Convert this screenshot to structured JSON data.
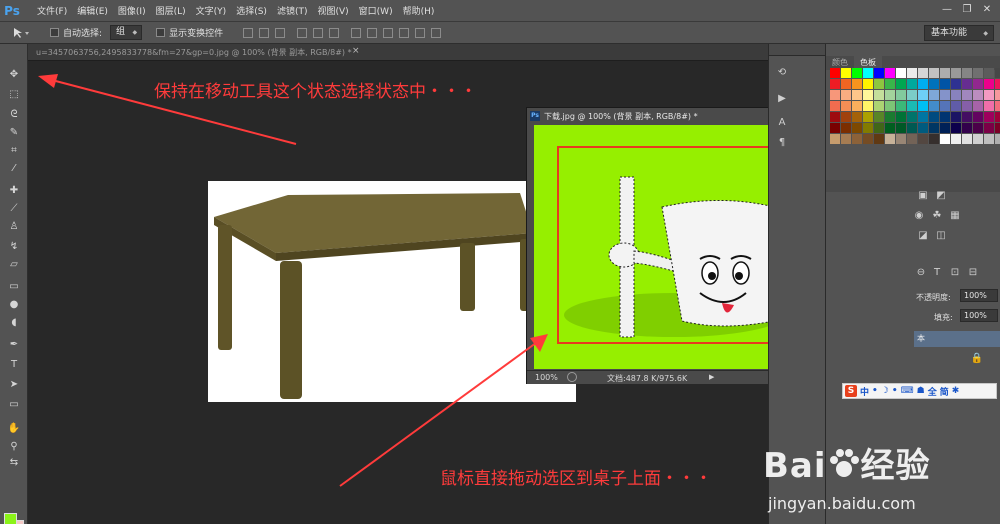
{
  "app": {
    "logo": "Ps"
  },
  "menu": [
    "文件(F)",
    "编辑(E)",
    "图像(I)",
    "图层(L)",
    "文字(Y)",
    "选择(S)",
    "滤镜(T)",
    "视图(V)",
    "窗口(W)",
    "帮助(H)"
  ],
  "window_controls": {
    "minimize": "—",
    "restore": "❐",
    "close": "✕"
  },
  "options": {
    "auto_select_label": "自动选择:",
    "auto_select_value": "组",
    "show_transform_label": "显示变换控件",
    "workspace": "基本功能"
  },
  "doc_tab": {
    "title": "u=3457063756,2495833778&fm=27&gp=0.jpg @ 100% (背景 副本, RGB/8#) *",
    "close": "×"
  },
  "float_window": {
    "title": "下载.jpg @ 100% (背景 副本, RGB/8#) *",
    "zoom": "100%",
    "doc_info": "文档:487.8 K/975.6K",
    "ps_badge": "Ps",
    "btn_min": "—",
    "btn_max": "☐",
    "btn_close": "✕",
    "status_arrow": "▶"
  },
  "panels": {
    "tab_color": "颜色",
    "tab_swatches": "色板",
    "opacity_label": "不透明度:",
    "opacity_value": "100%",
    "fill_label": "填充:",
    "fill_value": "100%",
    "layer_name": "本"
  },
  "annotations": {
    "top": "保持在移动工具这个状态选择状态中・・・",
    "bottom": "鼠标直接拖动选区到桌子上面・・・"
  },
  "ime": {
    "logo": "S",
    "items": [
      "中",
      "•",
      "☽",
      "•",
      "⌨",
      "☗",
      "全",
      "简",
      "✱"
    ]
  },
  "watermark": {
    "brand": "Bai",
    "brand2": "经验",
    "url": "jingyan.baidu.com"
  },
  "colors": {
    "canvas_green": "#96ef00",
    "annotation_red": "#ff3b3b",
    "table_brown": "#6e6232",
    "panel_gray": "#535353"
  }
}
